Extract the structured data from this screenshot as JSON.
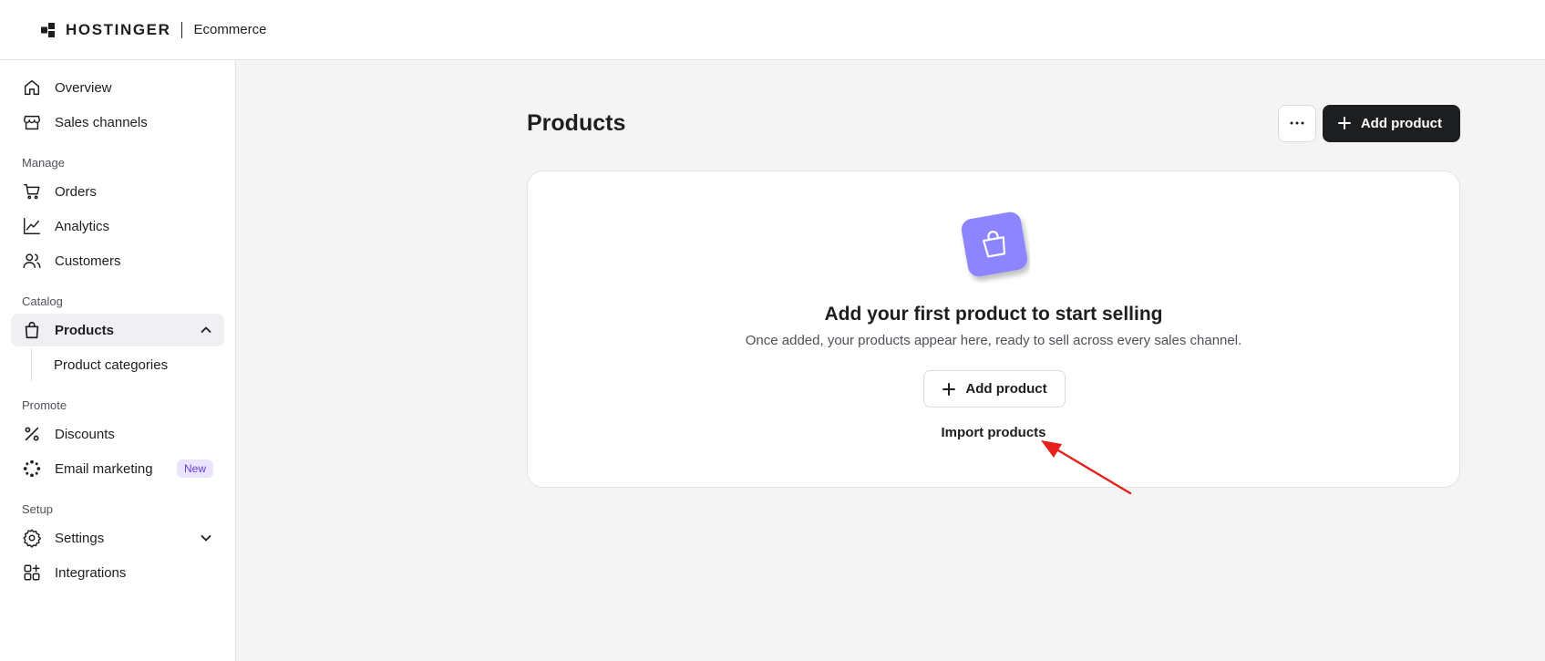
{
  "header": {
    "brand": "HOSTINGER",
    "product": "Ecommerce"
  },
  "sidebar": {
    "top_items": [
      {
        "label": "Overview",
        "icon": "home-icon"
      },
      {
        "label": "Sales channels",
        "icon": "store-icon"
      }
    ],
    "sections": [
      {
        "label": "Manage",
        "items": [
          {
            "label": "Orders",
            "icon": "cart-icon"
          },
          {
            "label": "Analytics",
            "icon": "chart-icon"
          },
          {
            "label": "Customers",
            "icon": "users-icon"
          }
        ]
      },
      {
        "label": "Catalog",
        "items": [
          {
            "label": "Products",
            "icon": "bag-icon",
            "active": true,
            "expanded": true
          },
          {
            "label": "Product categories"
          }
        ]
      },
      {
        "label": "Promote",
        "items": [
          {
            "label": "Discounts",
            "icon": "percent-icon"
          },
          {
            "label": "Email marketing",
            "icon": "sparkle-icon",
            "badge": "New"
          }
        ]
      },
      {
        "label": "Setup",
        "items": [
          {
            "label": "Settings",
            "icon": "gear-icon"
          },
          {
            "label": "Integrations",
            "icon": "integrations-icon"
          }
        ]
      }
    ]
  },
  "main": {
    "title": "Products",
    "more_label": "⋯",
    "add_button": "Add product",
    "empty_state": {
      "title": "Add your first product to start selling",
      "subtitle": "Once added, your products appear here, ready to sell across every sales channel.",
      "add_button": "Add product",
      "import_link": "Import products"
    }
  },
  "colors": {
    "accent": "#673de6",
    "illustration": "#8c85ff",
    "annotation": "#e8201c"
  }
}
